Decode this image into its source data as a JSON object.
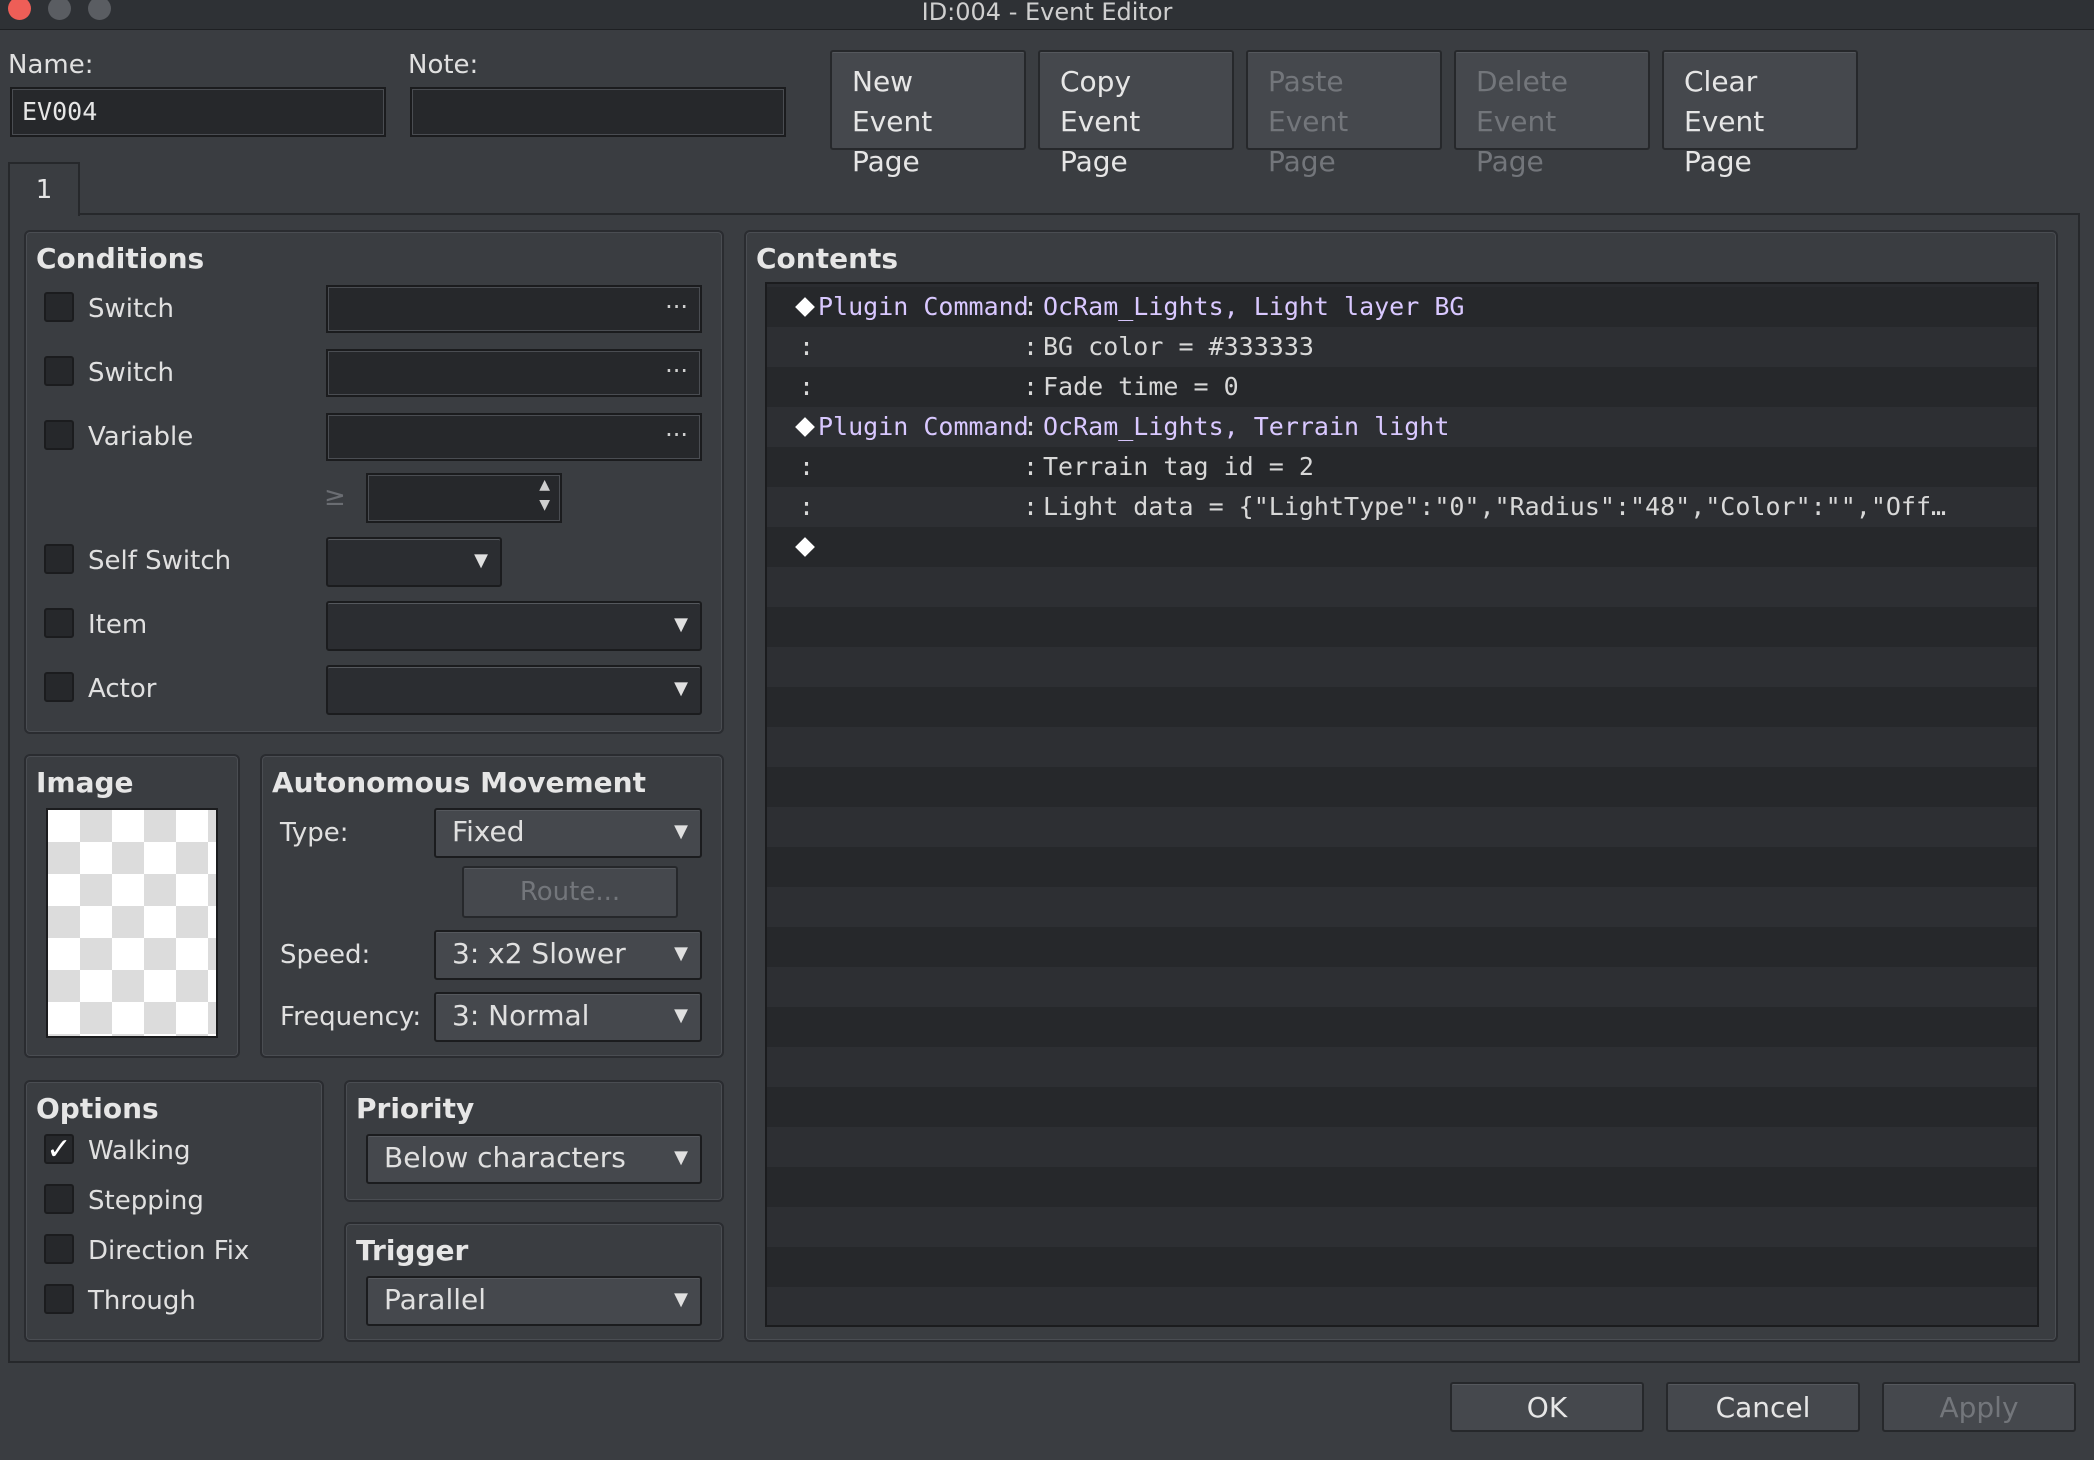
{
  "window": {
    "title": "ID:004 - Event Editor"
  },
  "name_label": "Name:",
  "name_value": "EV004",
  "note_label": "Note:",
  "note_value": "",
  "page_buttons": [
    {
      "line1": "New",
      "line2": "Event Page",
      "enabled": true
    },
    {
      "line1": "Copy",
      "line2": "Event Page",
      "enabled": true
    },
    {
      "line1": "Paste",
      "line2": "Event Page",
      "enabled": false
    },
    {
      "line1": "Delete",
      "line2": "Event Page",
      "enabled": false
    },
    {
      "line1": "Clear",
      "line2": "Event Page",
      "enabled": true
    }
  ],
  "tabs": [
    {
      "label": "1"
    }
  ],
  "conditions": {
    "title": "Conditions",
    "switch1": {
      "label": "Switch",
      "checked": false,
      "value": ""
    },
    "switch2": {
      "label": "Switch",
      "checked": false,
      "value": ""
    },
    "variable": {
      "label": "Variable",
      "checked": false,
      "value": "",
      "operator": "≥",
      "number": ""
    },
    "self_switch": {
      "label": "Self Switch",
      "checked": false,
      "value": ""
    },
    "item": {
      "label": "Item",
      "checked": false,
      "value": ""
    },
    "actor": {
      "label": "Actor",
      "checked": false,
      "value": ""
    }
  },
  "image": {
    "title": "Image"
  },
  "movement": {
    "title": "Autonomous Movement",
    "type_label": "Type:",
    "type_value": "Fixed",
    "route_label": "Route...",
    "speed_label": "Speed:",
    "speed_value": "3: x2 Slower",
    "frequency_label": "Frequency:",
    "frequency_value": "3: Normal"
  },
  "options": {
    "title": "Options",
    "walking": {
      "label": "Walking",
      "checked": true
    },
    "stepping": {
      "label": "Stepping",
      "checked": false
    },
    "direction_fix": {
      "label": "Direction Fix",
      "checked": false
    },
    "through": {
      "label": "Through",
      "checked": false
    }
  },
  "priority": {
    "title": "Priority",
    "value": "Below characters"
  },
  "trigger": {
    "title": "Trigger",
    "value": "Parallel"
  },
  "contents": {
    "title": "Contents",
    "commands": [
      {
        "type": "Plugin Command",
        "text": "OcRam_Lights, Light layer BG"
      },
      {
        "type": "",
        "text": "BG color = #333333"
      },
      {
        "type": "",
        "text": "Fade time = 0"
      },
      {
        "type": "Plugin Command",
        "text": "OcRam_Lights, Terrain light"
      },
      {
        "type": "",
        "text": "Terrain tag id = 2"
      },
      {
        "type": "",
        "text": "Light data = {\"LightType\":\"0\",\"Radius\":\"48\",\"Color\":\"\",\"Off…"
      }
    ]
  },
  "footer": {
    "ok": "OK",
    "cancel": "Cancel",
    "apply": "Apply"
  },
  "colors": {
    "close": "#ee5e57",
    "minimize": "#5a5d62",
    "zoom": "#5a5d62",
    "plugin_text": "#d9c8ff"
  }
}
